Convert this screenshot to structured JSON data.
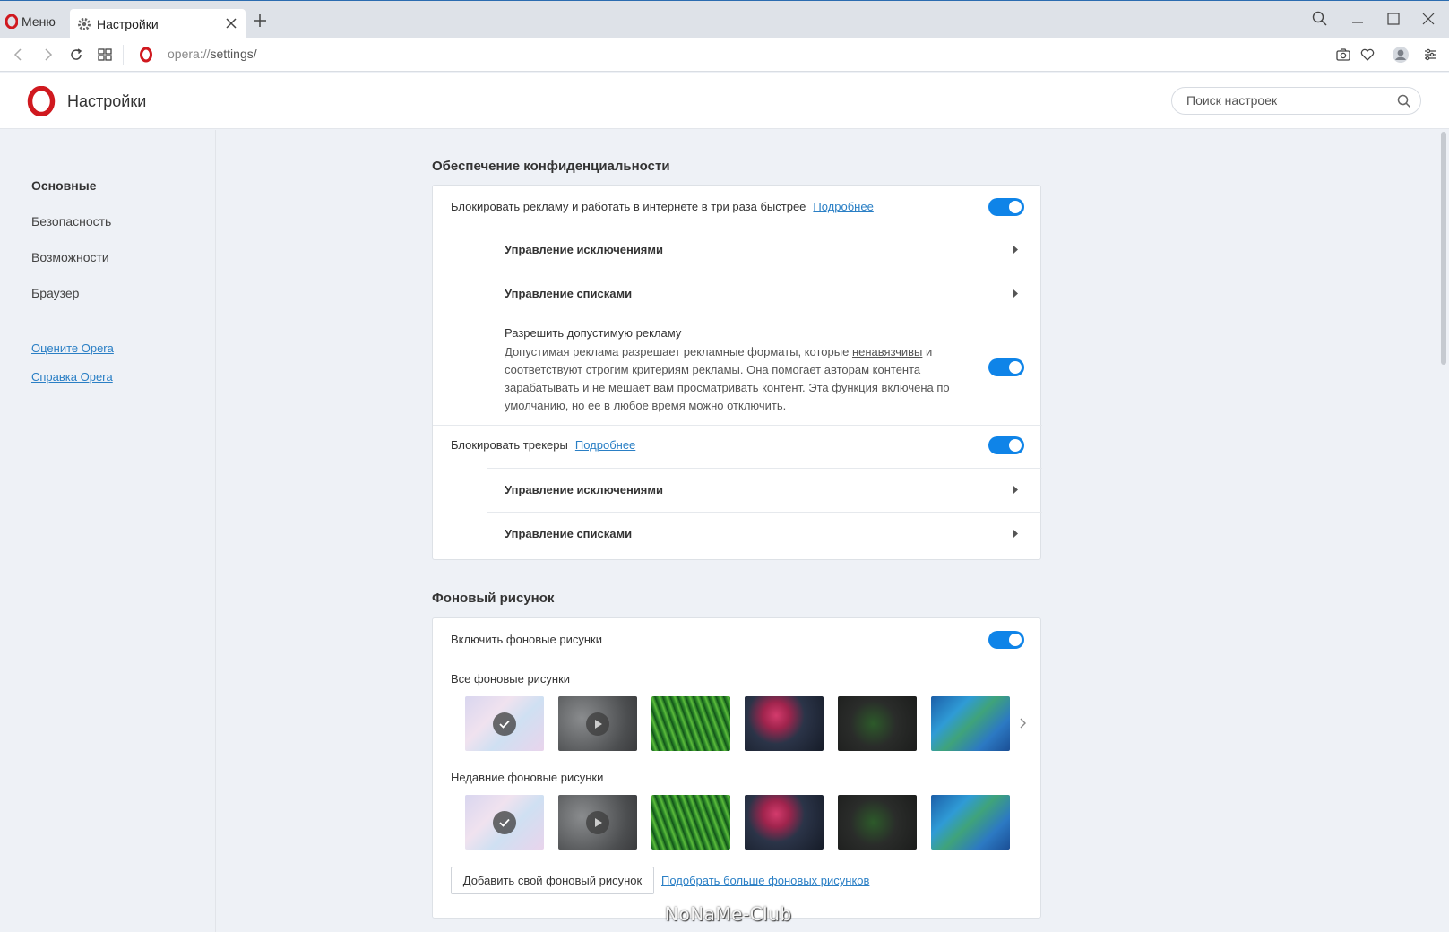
{
  "browser": {
    "menu_label": "Меню",
    "tab_title": "Настройки",
    "url_scheme": "opera://",
    "url_path": "settings/"
  },
  "header": {
    "title": "Настройки",
    "search_placeholder": "Поиск настроек"
  },
  "sidebar": {
    "items": [
      {
        "label": "Основные",
        "active": true
      },
      {
        "label": "Безопасность",
        "active": false
      },
      {
        "label": "Возможности",
        "active": false
      },
      {
        "label": "Браузер",
        "active": false
      }
    ],
    "links": [
      "Оцените Opera",
      "Справка Opera"
    ]
  },
  "privacy": {
    "title": "Обеспечение конфиденциальности",
    "block_ads_label": "Блокировать рекламу и работать в интернете в три раза быстрее",
    "learn_more": "Подробнее",
    "block_ads_enabled": true,
    "manage_exceptions": "Управление исключениями",
    "manage_lists": "Управление списками",
    "acceptable_ads_title": "Разрешить допустимую рекламу",
    "acceptable_ads_desc_1": "Допустимая реклама разрешает рекламные форматы, которые ",
    "acceptable_ads_desc_link": "ненавязчивы",
    "acceptable_ads_desc_2": " и соответствуют строгим критериям рекламы. Она помогает авторам контента зарабатывать и не мешает вам просматривать контент. Эта функция включена по умолчанию, но ее в любое время можно отключить.",
    "acceptable_ads_enabled": true,
    "block_trackers_label": "Блокировать трекеры",
    "block_trackers_enabled": true
  },
  "wallpaper": {
    "title": "Фоновый рисунок",
    "enable_label": "Включить фоновые рисунки",
    "enable_enabled": true,
    "all_label": "Все фоновые рисунки",
    "recent_label": "Недавние фоновые рисунки",
    "add_button": "Добавить свой фоновый рисунок",
    "more_link": "Подобрать больше фоновых рисунков"
  },
  "watermark": "NoNaMe-Club",
  "colors": {
    "accent": "#0f84e8",
    "link": "#2a7fc5",
    "opera_red": "#d0191f"
  }
}
